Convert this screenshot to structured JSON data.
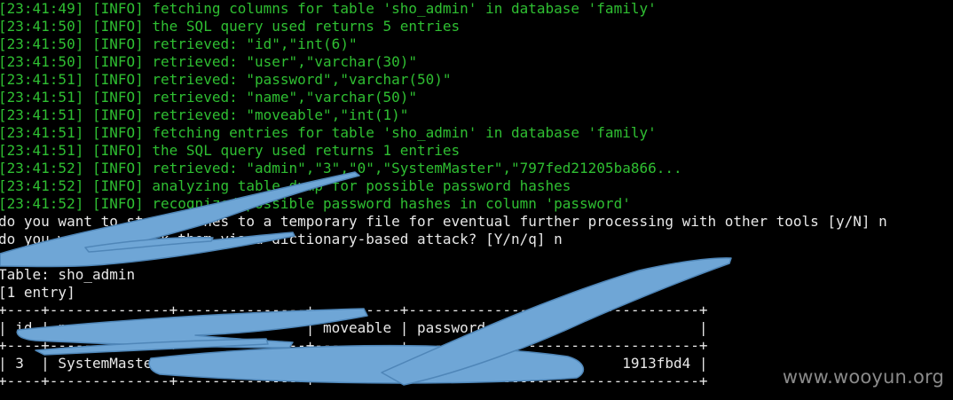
{
  "terminal": {
    "log_lines": [
      "[23:41:49] [INFO] fetching columns for table 'sho_admin' in database 'family'",
      "[23:41:50] [INFO] the SQL query used returns 5 entries",
      "[23:41:50] [INFO] retrieved: \"id\",\"int(6)\"",
      "[23:41:50] [INFO] retrieved: \"user\",\"varchar(30)\"",
      "[23:41:51] [INFO] retrieved: \"password\",\"varchar(50)\"",
      "[23:41:51] [INFO] retrieved: \"name\",\"varchar(50)\"",
      "[23:41:51] [INFO] retrieved: \"moveable\",\"int(1)\"",
      "[23:41:51] [INFO] fetching entries for table 'sho_admin' in database 'family'",
      "[23:41:51] [INFO] the SQL query used returns 1 entries",
      "[23:41:52] [INFO] retrieved: \"admin\",\"3\",\"0\",\"SystemMaster\",\"797fed21205ba866...",
      "[23:41:52] [INFO] analyzing table dump for possible password hashes",
      "[23:41:52] [INFO] recognized possible password hashes in column 'password'"
    ],
    "prompt_lines": [
      "do you want to store hashes to a temporary file for eventual further processing with other tools [y/N] n",
      "do you want to crack them via a dictionary-based attack? [Y/n/q] n"
    ],
    "table_info": [
      "Table: sho_admin",
      "[1 entry]"
    ],
    "table_lines": [
      "+----+--------------+---------------+----------+----------------------------------+",
      "| id | name         | user          | moveable | password                         |",
      "+----+--------------+---------------+----------+----------------------------------+",
      "| 3  | SystemMaster |               |          |                         1913fbd4 |",
      "+----+--------------+---------------+----------+----------------------------------+"
    ]
  },
  "watermark": "www.wooyun.org",
  "colors": {
    "background": "#000000",
    "log_text": "#2fbf32",
    "plain_text": "#e8e8e8",
    "scribble": "#6fa6d6"
  }
}
